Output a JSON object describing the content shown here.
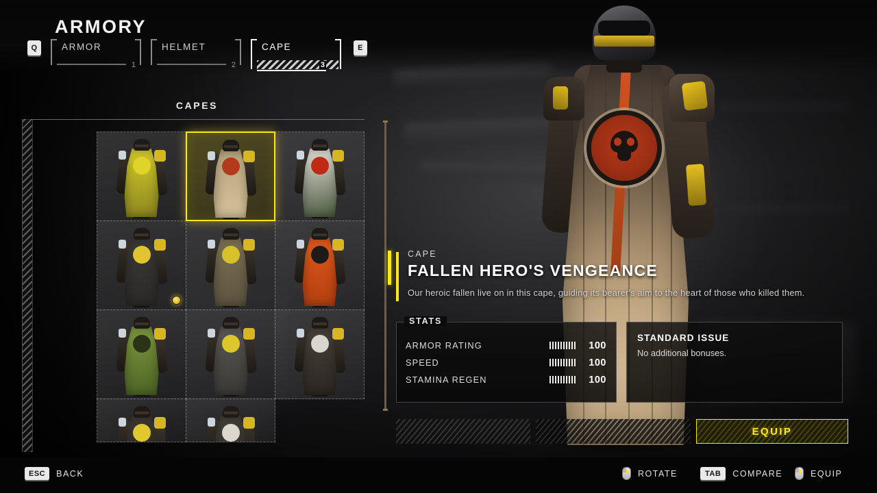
{
  "header": {
    "title": "ARMORY",
    "prev_key": "Q",
    "next_key": "E",
    "tabs": [
      {
        "label": "ARMOR",
        "number": "1",
        "active": false
      },
      {
        "label": "HELMET",
        "number": "2",
        "active": false
      },
      {
        "label": "CAPE",
        "number": "3",
        "active": true
      }
    ]
  },
  "grid": {
    "title": "CAPES",
    "items": [
      {
        "id": "cape-1",
        "cape_colors": "#d8cf2a,#8a8420",
        "emblem": "#e0d32a",
        "selected": false,
        "is_new": false
      },
      {
        "id": "cape-2",
        "cape_colors": "#b4a07c,#d6c39c",
        "emblem": "#b33a1a",
        "selected": true,
        "is_new": false
      },
      {
        "id": "cape-3",
        "cape_colors": "#e6e3dc,#4c5a3e",
        "emblem": "#c02a12",
        "selected": false,
        "is_new": false
      },
      {
        "id": "cape-4",
        "cape_colors": "#3b3a38,#2a2926",
        "emblem": "#e2c431",
        "selected": false,
        "is_new": true
      },
      {
        "id": "cape-5",
        "cape_colors": "#7d7256,#5c5340",
        "emblem": "#d8c22c",
        "selected": false,
        "is_new": false
      },
      {
        "id": "cape-6",
        "cape_colors": "#e25a1c,#b23f10",
        "emblem": "#1d1a17",
        "selected": false,
        "is_new": false
      },
      {
        "id": "cape-7",
        "cape_colors": "#7e9a3e,#4d6327",
        "emblem": "#2a3318",
        "selected": false,
        "is_new": false
      },
      {
        "id": "cape-8",
        "cape_colors": "#5c5a56,#3a3834",
        "emblem": "#ddc72e",
        "selected": false,
        "is_new": false
      },
      {
        "id": "cape-9",
        "cape_colors": "#48423a,#2b2620",
        "emblem": "#d9d6cf",
        "selected": false,
        "is_new": false
      },
      {
        "id": "cape-10",
        "cape_colors": "#3e3a34,#24211c",
        "emblem": "#e0c82f",
        "selected": false,
        "is_new": false
      },
      {
        "id": "cape-11",
        "cape_colors": "#44403a,#262320",
        "emblem": "#dcd8d0",
        "selected": false,
        "is_new": false
      }
    ],
    "scroll_position_percent": 45
  },
  "detail": {
    "kind": "CAPE",
    "name": "FALLEN HERO'S VENGEANCE",
    "description": "Our heroic fallen live on in this cape, guiding its bearer's aim to the heart of those who killed them."
  },
  "stats": {
    "legend": "STATS",
    "rows": [
      {
        "label": "ARMOR RATING",
        "value": "100",
        "filled_segments": 10,
        "total_segments": 10
      },
      {
        "label": "SPEED",
        "value": "100",
        "filled_segments": 10,
        "total_segments": 10
      },
      {
        "label": "STAMINA REGEN",
        "value": "100",
        "filled_segments": 10,
        "total_segments": 10
      }
    ]
  },
  "perk": {
    "title": "STANDARD ISSUE",
    "description": "No additional bonuses."
  },
  "actions": {
    "equip_label": "EQUIP"
  },
  "footer": {
    "hints": [
      {
        "key": "ESC",
        "icon": "key-badge",
        "label": "BACK"
      },
      {
        "key": "",
        "icon": "mouse-icon",
        "label": "ROTATE"
      },
      {
        "key": "TAB",
        "icon": "key-badge",
        "label": "COMPARE"
      },
      {
        "key": "",
        "icon": "mouse-icon",
        "label": "EQUIP"
      }
    ]
  },
  "colors": {
    "accent_yellow": "#ffe81a",
    "panel_border": "#969696",
    "text_primary": "#ffffff",
    "text_secondary": "#d2d2d2",
    "emblem_red": "#b33a1a"
  }
}
